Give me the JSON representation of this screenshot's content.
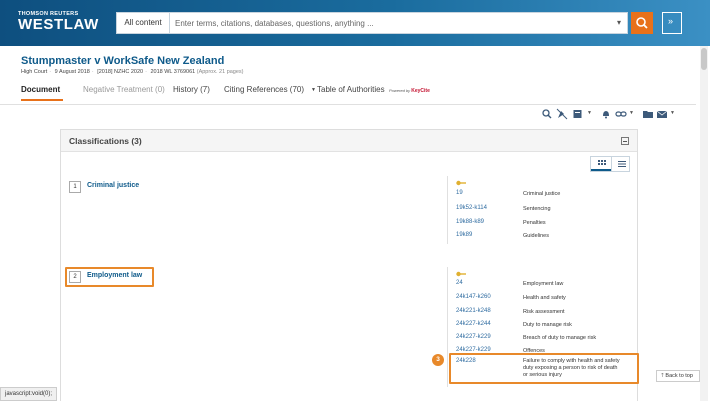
{
  "brand": {
    "top": "THOMSON REUTERS",
    "name": "WESTLAW"
  },
  "search": {
    "scope": "All content",
    "placeholder": "Enter terms, citations, databases, questions, anything ..."
  },
  "document": {
    "title": "Stumpmaster v WorkSafe New Zealand",
    "court": "High Court",
    "date": "9 August 2018",
    "citation": "[2018] NZHC 2020",
    "wl": "2018 WL 3769061",
    "approx": "(Approx. 21 pages)"
  },
  "tabs": [
    {
      "label": "Document"
    },
    {
      "label": "Negative Treatment (0)"
    },
    {
      "label": "History (7)"
    },
    {
      "label": "Citing References (70)"
    },
    {
      "label": "Table of Authorities"
    }
  ],
  "keycite": {
    "powered": "Powered by",
    "name": "KeyCite"
  },
  "panel": {
    "title": "Classifications (3)"
  },
  "classifications": [
    {
      "num": "1",
      "name": "Criminal justice",
      "entries": [
        {
          "code": "19",
          "label": "Criminal justice"
        },
        {
          "code": "19k52-k114",
          "label": "Sentencing"
        },
        {
          "code": "19k88-k89",
          "label": "Penalties"
        },
        {
          "code": "19k89",
          "label": "Guidelines"
        }
      ]
    },
    {
      "num": "2",
      "name": "Employment law",
      "entries": [
        {
          "code": "24",
          "label": "Employment law"
        },
        {
          "code": "24k147-k260",
          "label": "Health and safety"
        },
        {
          "code": "24k221-k248",
          "label": "Risk assessment"
        },
        {
          "code": "24k227-k244",
          "label": "Duty to manage risk"
        },
        {
          "code": "24k227-k229",
          "label": "Breach of duty to manage risk"
        },
        {
          "code": "24k227-k229",
          "label": "Offences"
        },
        {
          "code": "24k228",
          "label": "Failure to comply with health and safety",
          "label2": "duty exposing a person to risk of death",
          "label3": "or serious injury"
        }
      ]
    }
  ],
  "annotation": {
    "badge": "3"
  },
  "back_to_top": "Back to top",
  "status_bar": "javascript:void(0);",
  "colors": {
    "accent": "#e8711a",
    "link": "#0e5a8a",
    "header": "#1a6c9e"
  }
}
